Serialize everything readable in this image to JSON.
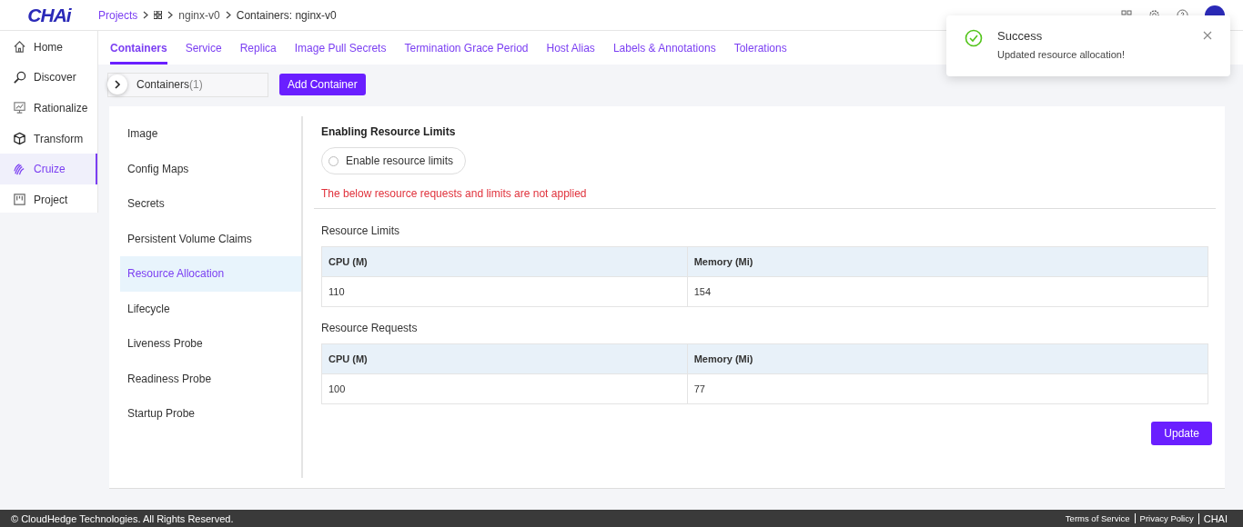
{
  "header": {
    "logo": "CHAi",
    "breadcrumbs": [
      {
        "label": "Projects",
        "kind": "link"
      },
      {
        "label": "nginx-v0",
        "kind": "text"
      },
      {
        "label": "Containers: nginx-v0",
        "kind": "current"
      }
    ]
  },
  "sidebar": {
    "items": [
      {
        "label": "Home",
        "selected": false
      },
      {
        "label": "Discover",
        "selected": false
      },
      {
        "label": "Rationalize",
        "selected": false
      },
      {
        "label": "Transform",
        "selected": false
      },
      {
        "label": "Cruize",
        "selected": true
      },
      {
        "label": "Project",
        "selected": false
      }
    ]
  },
  "tabs": [
    {
      "label": "Containers",
      "selected": true
    },
    {
      "label": "Service",
      "selected": false
    },
    {
      "label": "Replica",
      "selected": false
    },
    {
      "label": "Image Pull Secrets",
      "selected": false
    },
    {
      "label": "Termination Grace Period",
      "selected": false
    },
    {
      "label": "Host Alias",
      "selected": false
    },
    {
      "label": "Labels & Annotations",
      "selected": false
    },
    {
      "label": "Tolerations",
      "selected": false
    }
  ],
  "containers": {
    "label": "Containers",
    "count": "(1)",
    "add_button": "Add Container"
  },
  "sections": [
    {
      "label": "Image",
      "selected": false
    },
    {
      "label": "Config Maps",
      "selected": false
    },
    {
      "label": "Secrets",
      "selected": false
    },
    {
      "label": "Persistent Volume Claims",
      "selected": false
    },
    {
      "label": "Resource Allocation",
      "selected": true
    },
    {
      "label": "Lifecycle",
      "selected": false
    },
    {
      "label": "Liveness Probe",
      "selected": false
    },
    {
      "label": "Readiness Probe",
      "selected": false
    },
    {
      "label": "Startup Probe",
      "selected": false
    }
  ],
  "resource": {
    "heading": "Enabling Resource Limits",
    "toggle": {
      "label": "Enable resource limits",
      "checked": false
    },
    "warning": "The below resource requests and limits are not applied",
    "tables": [
      {
        "title": "Resource Limits",
        "columns": [
          "CPU (M)",
          "Memory (Mi)"
        ],
        "rows": [
          [
            "110",
            "154"
          ]
        ]
      },
      {
        "title": "Resource Requests",
        "columns": [
          "CPU (M)",
          "Memory (Mi)"
        ],
        "rows": [
          [
            "100",
            "77"
          ]
        ]
      }
    ],
    "update_button": "Update"
  },
  "toast": {
    "title": "Success",
    "message": "Updated resource allocation!"
  },
  "footer": {
    "copyright": "© CloudHedge Technologies. All Rights Reserved.",
    "links": [
      "Terms of Service",
      "Privacy Policy"
    ],
    "brand": "CHAI"
  }
}
